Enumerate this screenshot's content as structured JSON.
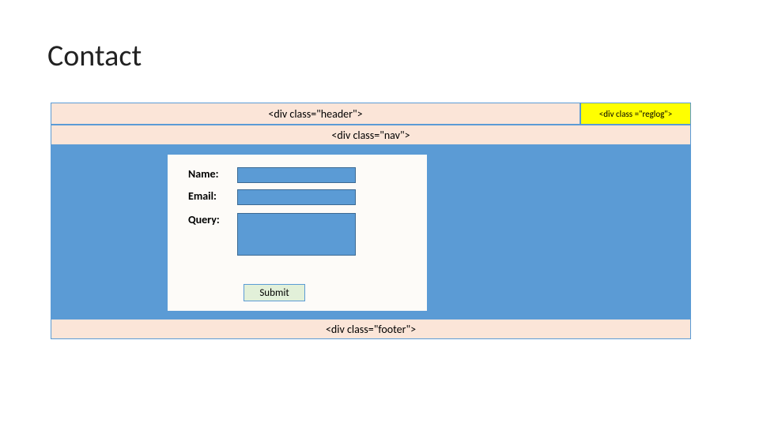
{
  "title": "Contact",
  "header": {
    "label": "<div class=\"header\">"
  },
  "reglog": {
    "label": "<div class =\"reglog\">"
  },
  "nav": {
    "label": "<div class=\"nav\">"
  },
  "form": {
    "name_label": "Name:",
    "email_label": "Email:",
    "query_label": "Query:",
    "submit_label": "Submit"
  },
  "footer": {
    "label": "<div class=\"footer\">"
  }
}
